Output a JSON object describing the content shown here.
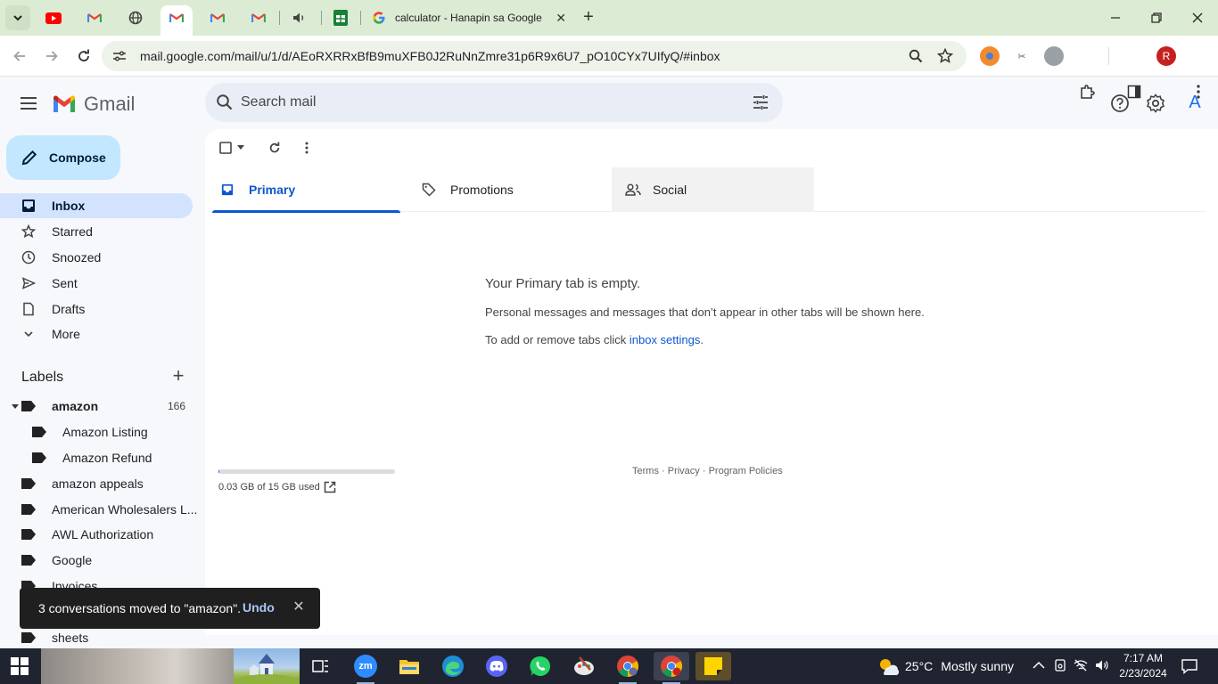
{
  "browser": {
    "tabs": [
      {
        "id": "tab-1",
        "title": "",
        "icon": "youtube-icon"
      },
      {
        "id": "tab-2",
        "title": "",
        "icon": "gmail-icon"
      },
      {
        "id": "tab-3",
        "title": "",
        "icon": "globe-icon"
      },
      {
        "id": "tab-4",
        "title": "",
        "icon": "gmail-icon",
        "active": true
      },
      {
        "id": "tab-5",
        "title": "",
        "icon": "gmail-icon"
      },
      {
        "id": "tab-6",
        "title": "",
        "icon": "gmail-icon"
      },
      {
        "id": "tab-7",
        "title": "",
        "icon": "speaker-icon"
      },
      {
        "id": "tab-8",
        "title": "",
        "icon": "sheets-icon"
      },
      {
        "id": "tab-9",
        "title": "calculator - Hanapin sa Google",
        "icon": "google-icon"
      }
    ],
    "url": "mail.google.com/mail/u/1/d/AEoRXRRxBfB9muXFB0J2RuNnZmre31p6R9x6U7_pO10CYx7UIfyQ/#inbox",
    "profile_initial": "R"
  },
  "gmail": {
    "brand": "Gmail",
    "search_placeholder": "Search mail",
    "account_initial": "A",
    "compose_label": "Compose",
    "nav": [
      {
        "label": "Inbox",
        "icon": "inbox-icon",
        "active": true
      },
      {
        "label": "Starred",
        "icon": "star-icon"
      },
      {
        "label": "Snoozed",
        "icon": "clock-icon"
      },
      {
        "label": "Sent",
        "icon": "send-icon"
      },
      {
        "label": "Drafts",
        "icon": "draft-icon"
      },
      {
        "label": "More",
        "icon": "chevron-down-icon"
      }
    ],
    "labels_heading": "Labels",
    "labels": [
      {
        "name": "amazon",
        "count": "166",
        "bold": true,
        "expanded": true
      },
      {
        "name": "Amazon Listing",
        "child": true
      },
      {
        "name": "Amazon Refund",
        "child": true
      },
      {
        "name": "amazon appeals"
      },
      {
        "name": "American Wholesalers L..."
      },
      {
        "name": "AWL Authorization"
      },
      {
        "name": "Google"
      },
      {
        "name": "Invoices"
      },
      {
        "name": "sheets"
      }
    ],
    "tabs": [
      {
        "label": "Primary",
        "icon": "inbox-tab-icon",
        "active": true
      },
      {
        "label": "Promotions",
        "icon": "tag-icon"
      },
      {
        "label": "Social",
        "icon": "people-icon"
      }
    ],
    "empty": {
      "title": "Your Primary tab is empty.",
      "description": "Personal messages and messages that don’t appear in other tabs will be shown here.",
      "settings_prefix": "To add or remove tabs click ",
      "settings_link": "inbox settings",
      "settings_suffix": "."
    },
    "storage": {
      "text": "0.03 GB of 15 GB used",
      "fraction": 0.002
    },
    "footer": {
      "terms": "Terms",
      "privacy": "Privacy",
      "policies": "Program Policies",
      "sep": " · "
    },
    "snackbar": {
      "message": "3 conversations moved to \"amazon\".",
      "action": "Undo"
    }
  },
  "taskbar": {
    "weather": {
      "temp": "25°C",
      "condition": "Mostly sunny"
    },
    "time": "7:17 AM",
    "date": "2/23/2024",
    "apps": [
      "task-view-icon",
      "zoom-icon",
      "file-explorer-icon",
      "edge-icon",
      "discord-icon",
      "whatsapp-icon",
      "paint-icon",
      "chrome-icon",
      "chrome-icon",
      "sticky-notes-icon"
    ],
    "zoom_label": "zm"
  },
  "colors": {
    "tabstrip": "#dcebd3",
    "accent": "#0b57d0",
    "compose": "#c2e7ff",
    "active_nav": "#d3e3fd",
    "taskbar": "#1f2430"
  }
}
